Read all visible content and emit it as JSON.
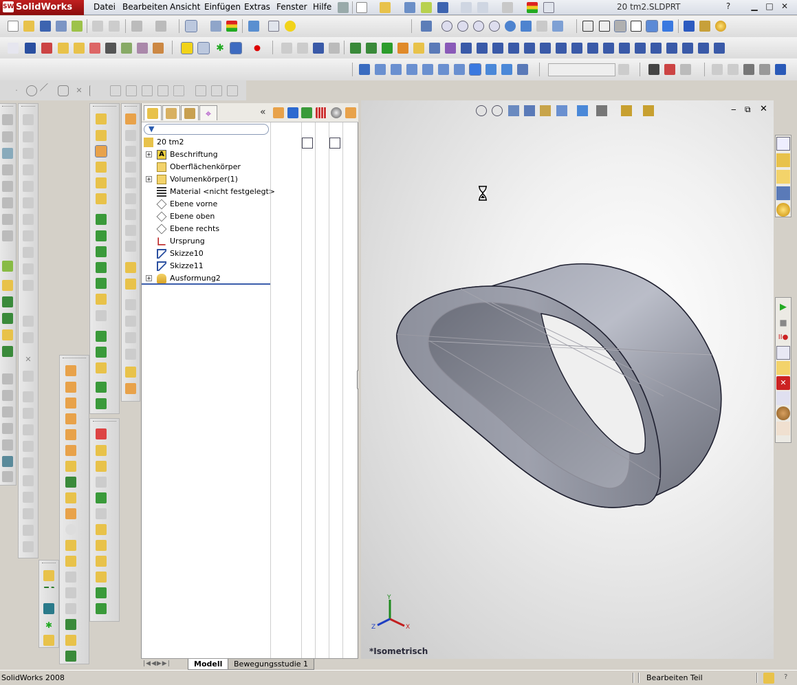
{
  "app": {
    "name": "SolidWorks",
    "document_title": "20 tm2.SLDPRT"
  },
  "menu": {
    "items": [
      "Datei",
      "Bearbeiten",
      "Ansicht",
      "Einfügen",
      "Extras",
      "Fenster",
      "Hilfe"
    ]
  },
  "feature_tree": {
    "root": "20 tm2",
    "items": [
      {
        "label": "Beschriftung",
        "icon": "annotation-icon",
        "expandable": true
      },
      {
        "label": "Oberflächenkörper",
        "icon": "surface-bodies-folder-icon",
        "expandable": false
      },
      {
        "label": "Volumenkörper(1)",
        "icon": "solid-bodies-folder-icon",
        "expandable": true
      },
      {
        "label": "Material <nicht festgelegt>",
        "icon": "material-icon",
        "expandable": false
      },
      {
        "label": "Ebene vorne",
        "icon": "plane-icon",
        "expandable": false
      },
      {
        "label": "Ebene oben",
        "icon": "plane-icon",
        "expandable": false
      },
      {
        "label": "Ebene rechts",
        "icon": "plane-icon",
        "expandable": false
      },
      {
        "label": "Ursprung",
        "icon": "origin-icon",
        "expandable": false
      },
      {
        "label": "Skizze10",
        "icon": "sketch-icon",
        "expandable": false
      },
      {
        "label": "Skizze11",
        "icon": "sketch-icon",
        "expandable": false
      },
      {
        "label": "Ausformung2",
        "icon": "loft-feature-icon",
        "expandable": true
      }
    ]
  },
  "bottom_tabs": [
    "Modell",
    "Bewegungsstudie 1"
  ],
  "viewport": {
    "view_orientation": "*Isometrisch",
    "triad": {
      "x": "X",
      "y": "Y",
      "z": "Z"
    }
  },
  "status": {
    "left": "SolidWorks 2008",
    "right": "Bearbeiten Teil"
  },
  "colors": {
    "model_face": "#8c8f9b",
    "model_light": "#b7bac4",
    "model_dark": "#5d606b",
    "rollback_bar": "#3b5dab",
    "brand": "#b01818"
  }
}
